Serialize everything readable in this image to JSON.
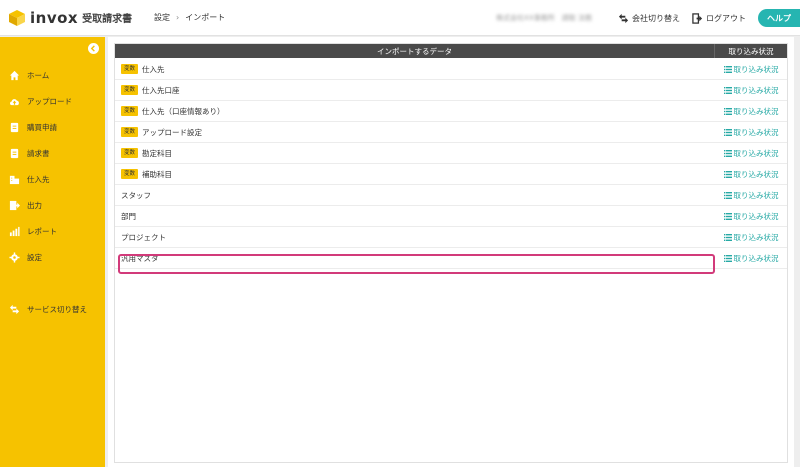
{
  "header": {
    "brand": "invox",
    "product": "受取請求書",
    "breadcrumb": [
      "設定",
      "インポート"
    ],
    "user_info": "株式会社XX事務所　請取 法務",
    "switch_company": "会社切り替え",
    "logout": "ログアウト",
    "help": "ヘルプ"
  },
  "sidebar": {
    "items": [
      {
        "label": "ホーム",
        "icon": "home-icon"
      },
      {
        "label": "アップロード",
        "icon": "cloud-upload-icon"
      },
      {
        "label": "購買申請",
        "icon": "document-icon"
      },
      {
        "label": "請求書",
        "icon": "invoice-icon"
      },
      {
        "label": "仕入先",
        "icon": "building-icon"
      },
      {
        "label": "出力",
        "icon": "export-icon"
      },
      {
        "label": "レポート",
        "icon": "chart-icon"
      },
      {
        "label": "設定",
        "icon": "gear-icon"
      },
      {
        "label": "サービス切り替え",
        "icon": "switch-icon"
      }
    ]
  },
  "table": {
    "header_data": "インポートするデータ",
    "header_status": "取り込み状況",
    "status_link": "取り込み状況",
    "badge_label": "変数",
    "rows": [
      {
        "name": "仕入先",
        "badge": true
      },
      {
        "name": "仕入先口座",
        "badge": true
      },
      {
        "name": "仕入先（口座情報あり）",
        "badge": true
      },
      {
        "name": "アップロード設定",
        "badge": true
      },
      {
        "name": "勘定科目",
        "badge": true
      },
      {
        "name": "補助科目",
        "badge": true
      },
      {
        "name": "スタッフ",
        "badge": false
      },
      {
        "name": "部門",
        "badge": false
      },
      {
        "name": "プロジェクト",
        "badge": false
      },
      {
        "name": "汎用マスタ",
        "badge": false,
        "highlighted": true
      }
    ]
  },
  "colors": {
    "sidebar": "#f6c200",
    "accent": "#26b5b1",
    "table_header": "#4a4a4a",
    "highlight": "#d23a7a"
  }
}
